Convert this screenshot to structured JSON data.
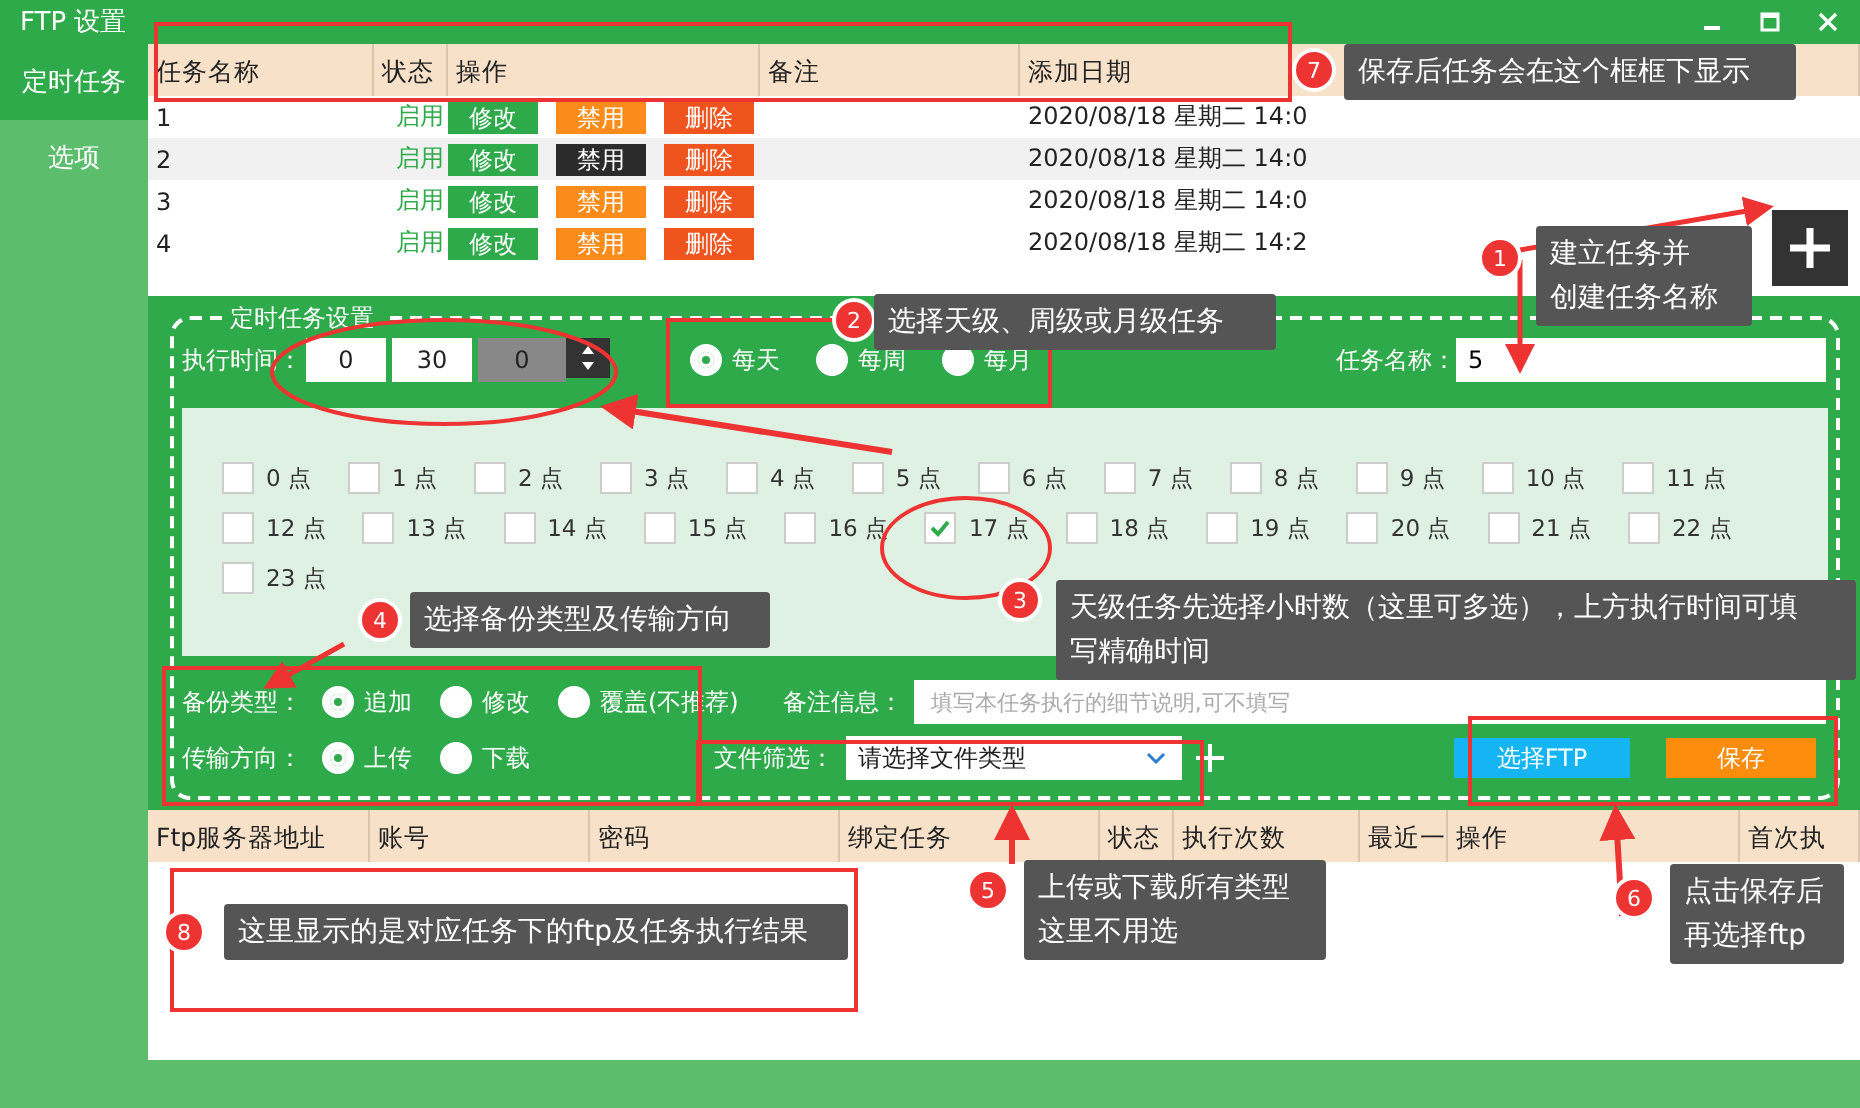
{
  "window": {
    "title": "FTP 设置"
  },
  "sidebar": {
    "items": [
      {
        "label": "定时任务",
        "selected": true
      },
      {
        "label": "选项",
        "selected": false
      }
    ]
  },
  "task_table": {
    "columns": [
      "任务名称",
      "状态",
      "操作",
      "备注",
      "添加日期"
    ],
    "rows": [
      {
        "name": "1",
        "status": "启用",
        "actions": [
          "修改",
          "禁用",
          "删除"
        ],
        "selected": false,
        "disable_pressed": false,
        "date": "2020/08/18 星期二 14:0"
      },
      {
        "name": "2",
        "status": "启用",
        "actions": [
          "修改",
          "禁用",
          "删除"
        ],
        "selected": true,
        "disable_pressed": true,
        "date": "2020/08/18 星期二 14:0"
      },
      {
        "name": "3",
        "status": "启用",
        "actions": [
          "修改",
          "禁用",
          "删除"
        ],
        "selected": false,
        "disable_pressed": false,
        "date": "2020/08/18 星期二 14:0"
      },
      {
        "name": "4",
        "status": "启用",
        "actions": [
          "修改",
          "禁用",
          "删除"
        ],
        "selected": false,
        "disable_pressed": false,
        "date": "2020/08/18 星期二 14:2"
      }
    ]
  },
  "schedule": {
    "title": "定时任务设置",
    "time_label": "执行时间：",
    "time": [
      "0",
      "30",
      "0"
    ],
    "frequency": [
      {
        "label": "每天",
        "selected": true
      },
      {
        "label": "每周",
        "selected": false
      },
      {
        "label": "每月",
        "selected": false
      }
    ],
    "task_name_label": "任务名称：",
    "task_name": "5",
    "hours": [
      {
        "label": "0 点",
        "checked": false
      },
      {
        "label": "1 点",
        "checked": false
      },
      {
        "label": "2 点",
        "checked": false
      },
      {
        "label": "3 点",
        "checked": false
      },
      {
        "label": "4 点",
        "checked": false
      },
      {
        "label": "5 点",
        "checked": false
      },
      {
        "label": "6 点",
        "checked": false
      },
      {
        "label": "7 点",
        "checked": false
      },
      {
        "label": "8 点",
        "checked": false
      },
      {
        "label": "9 点",
        "checked": false
      },
      {
        "label": "10 点",
        "checked": false
      },
      {
        "label": "11 点",
        "checked": false
      },
      {
        "label": "12 点",
        "checked": false
      },
      {
        "label": "13 点",
        "checked": false
      },
      {
        "label": "14 点",
        "checked": false
      },
      {
        "label": "15 点",
        "checked": false
      },
      {
        "label": "16 点",
        "checked": false
      },
      {
        "label": "17 点",
        "checked": true
      },
      {
        "label": "18 点",
        "checked": false
      },
      {
        "label": "19 点",
        "checked": false
      },
      {
        "label": "20 点",
        "checked": false
      },
      {
        "label": "21 点",
        "checked": false
      },
      {
        "label": "22 点",
        "checked": false
      },
      {
        "label": "23 点",
        "checked": false
      }
    ],
    "backup_type": {
      "label": "备份类型：",
      "options": [
        {
          "label": "追加",
          "selected": true
        },
        {
          "label": "修改",
          "selected": false
        },
        {
          "label": "覆盖(不推荐)",
          "selected": false
        }
      ]
    },
    "direction": {
      "label": "传输方向：",
      "options": [
        {
          "label": "上传",
          "selected": true
        },
        {
          "label": "下载",
          "selected": false
        }
      ]
    },
    "note": {
      "label": "备注信息：",
      "placeholder": "填写本任务执行的细节说明,可不填写"
    },
    "file_filter": {
      "label": "文件筛选：",
      "value": "请选择文件类型"
    },
    "buttons": [
      "选择FTP",
      "保存"
    ]
  },
  "ftp_table": {
    "columns": [
      "Ftp服务器地址",
      "账号",
      "密码",
      "绑定任务",
      "状态",
      "执行次数",
      "最近一",
      "操作",
      "首次执"
    ]
  },
  "annotations": [
    {
      "number": "7",
      "lines": [
        "保存后任务会在这个框框下显示"
      ]
    },
    {
      "number": "1",
      "lines": [
        "建立任务并",
        "创建任务名称"
      ]
    },
    {
      "number": "2",
      "lines": [
        "选择天级、周级或月级任务"
      ]
    },
    {
      "number": "4",
      "lines": [
        "选择备份类型及传输方向"
      ]
    },
    {
      "number": "3",
      "lines": [
        "天级任务先选择小时数（这里可多选），上方执行时间可填",
        "写精确时间"
      ]
    },
    {
      "number": "8",
      "lines": [
        "这里显示的是对应任务下的ftp及任务执行结果"
      ]
    },
    {
      "number": "5",
      "lines": [
        "上传或下载所有类型",
        "这里不用选"
      ]
    },
    {
      "number": "6",
      "lines": [
        "点击保存后",
        "再选择ftp"
      ]
    }
  ]
}
